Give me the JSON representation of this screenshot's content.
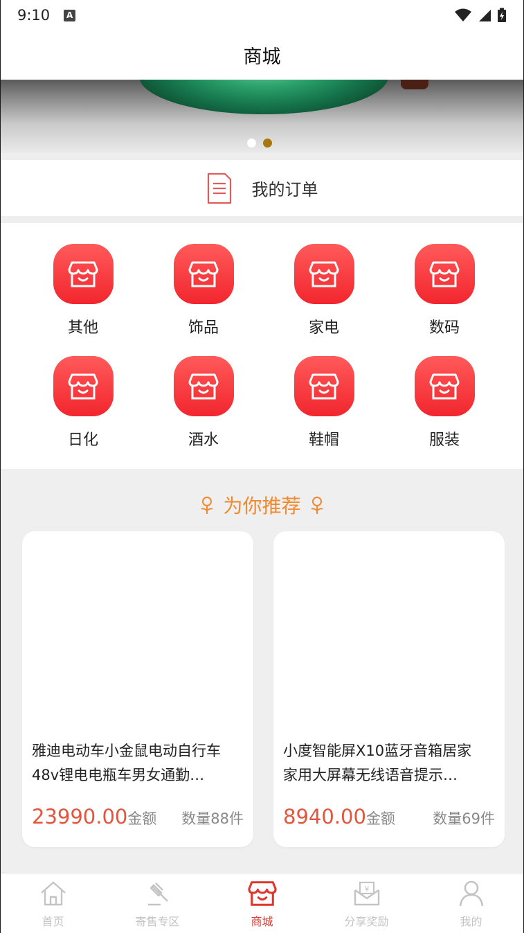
{
  "status_bar": {
    "time": "9:10",
    "badge": "A"
  },
  "header": {
    "title": "商城"
  },
  "banner": {
    "slide_count": 2,
    "active_index": 1,
    "colors": {
      "active_dot": "#a8770f",
      "inactive_dot": "#ffffff"
    }
  },
  "orders": {
    "label": "我的订单",
    "icon": "document-icon"
  },
  "categories": [
    {
      "label": "其他",
      "icon": "store-icon"
    },
    {
      "label": "饰品",
      "icon": "store-icon"
    },
    {
      "label": "家电",
      "icon": "store-icon"
    },
    {
      "label": "数码",
      "icon": "store-icon"
    },
    {
      "label": "日化",
      "icon": "store-icon"
    },
    {
      "label": "酒水",
      "icon": "store-icon"
    },
    {
      "label": "鞋帽",
      "icon": "store-icon"
    },
    {
      "label": "服装",
      "icon": "store-icon"
    }
  ],
  "recommend": {
    "title": "为你推荐",
    "items": [
      {
        "name_line1": "雅迪电动车小金鼠电动自行车",
        "name_line2": "48v锂电电瓶车男女通勤…",
        "price": "23990.00",
        "unit": "金额",
        "quantity": "数量88件"
      },
      {
        "name_line1": "小度智能屏X10蓝牙音箱居家",
        "name_line2": "家用大屏幕无线语音提示…",
        "price": "8940.00",
        "unit": "金额",
        "quantity": "数量69件"
      }
    ]
  },
  "tabs": [
    {
      "label": "首页",
      "icon": "home-icon",
      "active": false
    },
    {
      "label": "寄售专区",
      "icon": "auction-hammer-icon",
      "active": false
    },
    {
      "label": "商城",
      "icon": "store-icon",
      "active": true
    },
    {
      "label": "分享奖励",
      "icon": "envelope-yen-icon",
      "active": false
    },
    {
      "label": "我的",
      "icon": "person-icon",
      "active": false
    }
  ],
  "colors": {
    "brand_red": "#f2262e",
    "accent_orange": "#f08a30",
    "price_red": "#e2563d",
    "tab_active": "#e0362c",
    "tab_inactive": "#c4c4c4"
  }
}
